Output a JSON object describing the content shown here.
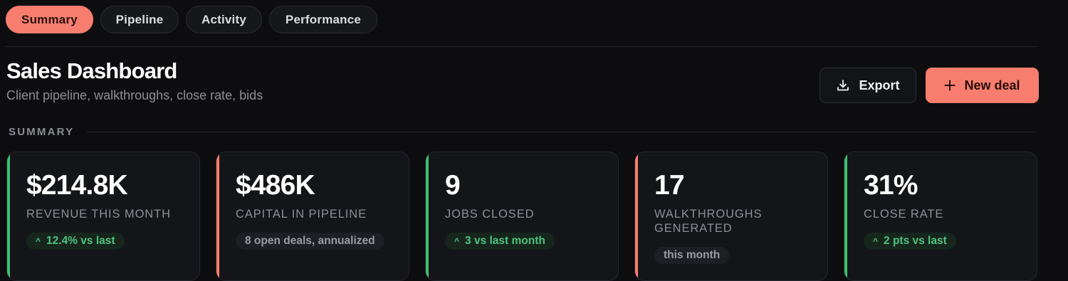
{
  "tabs": [
    {
      "label": "Summary",
      "active": true
    },
    {
      "label": "Pipeline",
      "active": false
    },
    {
      "label": "Activity",
      "active": false
    },
    {
      "label": "Performance",
      "active": false
    }
  ],
  "header": {
    "title": "Sales Dashboard",
    "subtitle": "Client pipeline, walkthroughs, close rate, bids"
  },
  "actions": {
    "export_label": "Export",
    "export_icon": "download-icon",
    "new_deal_label": "New deal",
    "new_deal_icon": "plus-icon"
  },
  "section": {
    "label": "SUMMARY"
  },
  "colors": {
    "accent": "#f77e6f",
    "positive": "#4ec27f",
    "background": "#0d0d0f",
    "card": "#141519"
  },
  "cards": [
    {
      "value": "$214.8K",
      "label": "REVENUE THIS MONTH",
      "badge": "12.4% vs last",
      "trend": "up",
      "accent_color": "#3fbf6e"
    },
    {
      "value": "$486K",
      "label": "CAPITAL IN PIPELINE",
      "badge": "8 open deals, annualized",
      "trend": "neutral",
      "accent_color": "#f77e6f"
    },
    {
      "value": "9",
      "label": "JOBS CLOSED",
      "badge": "3 vs last month",
      "trend": "up",
      "accent_color": "#3fbf6e"
    },
    {
      "value": "17",
      "label": "WALKTHROUGHS GENERATED",
      "badge": "this month",
      "trend": "neutral",
      "accent_color": "#f77e6f"
    },
    {
      "value": "31%",
      "label": "CLOSE RATE",
      "badge": "2 pts vs last",
      "trend": "up",
      "accent_color": "#3fbf6e"
    }
  ]
}
